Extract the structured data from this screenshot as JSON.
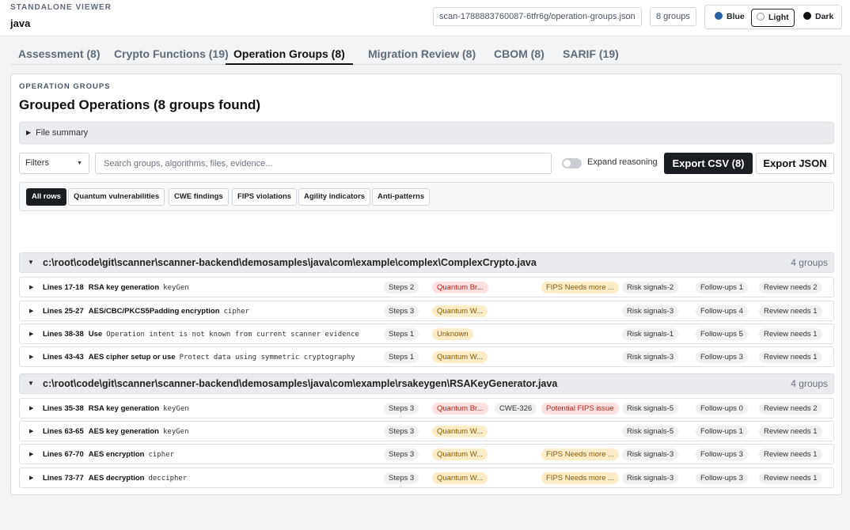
{
  "header": {
    "kicker": "STANDALONE VIEWER",
    "title": "java",
    "scan_file": "scan-1788883760087-6tfr6g/operation-groups.json",
    "group_count": "8 groups",
    "themes": [
      "Blue",
      "Light",
      "Dark"
    ],
    "theme_selected": "Light"
  },
  "tabs": [
    {
      "label": "Assessment (8)"
    },
    {
      "label": "Crypto Functions (19)"
    },
    {
      "label": "Operation Groups (8)"
    },
    {
      "label": "Migration Review (8)"
    },
    {
      "label": "CBOM (8)"
    },
    {
      "label": "SARIF (19)"
    }
  ],
  "active_tab": "Operation Groups (8)",
  "panel": {
    "kicker": "OPERATION GROUPS",
    "title": "Grouped Operations (8 groups found)",
    "file_summary": "File summary",
    "filters_label": "Filters",
    "search_placeholder": "Search groups, algorithms, files, evidence...",
    "expand_label": "Expand reasoning",
    "expand_on": false,
    "export_csv": "Export CSV (8)",
    "export_json": "Export JSON",
    "chips": [
      "All rows",
      "Quantum vulnerabilities",
      "CWE findings",
      "FIPS violations",
      "Agility indicators",
      "Anti-patterns"
    ],
    "chip_active": "All rows"
  },
  "files": [
    {
      "path": "c:\\root\\code\\git\\scanner\\scanner-backend\\demosamples\\java\\com\\example\\complex\\ComplexCrypto.java",
      "count": "4 groups",
      "rows": [
        {
          "lines": "Lines 17-18",
          "name": "RSA key generation",
          "code": "keyGen",
          "steps": "Steps 2",
          "quantum": "Quantum Br...",
          "cwe": "",
          "fips": "FIPS Needs more ...",
          "risk": "Risk signals-2",
          "followups": "Follow-ups 1",
          "review": "Review needs 2"
        },
        {
          "lines": "Lines 25-27",
          "name": "AES/CBC/PKCS5Padding encryption",
          "code": "cipher",
          "steps": "Steps 3",
          "quantum": "Quantum W...",
          "cwe": "",
          "fips": "",
          "risk": "Risk signals-3",
          "followups": "Follow-ups 4",
          "review": "Review needs 1"
        },
        {
          "lines": "Lines 38-38",
          "name": "Use",
          "code": "Operation intent is not known from current scanner evidence",
          "steps": "Steps 1",
          "quantum": "Unknown",
          "cwe": "",
          "fips": "",
          "risk": "Risk signals-1",
          "followups": "Follow-ups 5",
          "review": "Review needs 1"
        },
        {
          "lines": "Lines 43-43",
          "name": "AES cipher setup or use",
          "code": "Protect data using symmetric cryptography",
          "steps": "Steps 1",
          "quantum": "Quantum W...",
          "cwe": "",
          "fips": "",
          "risk": "Risk signals-3",
          "followups": "Follow-ups 3",
          "review": "Review needs 1"
        }
      ]
    },
    {
      "path": "c:\\root\\code\\git\\scanner\\scanner-backend\\demosamples\\java\\com\\example\\rsakeygen\\RSAKeyGenerator.java",
      "count": "4 groups",
      "rows": [
        {
          "lines": "Lines 35-38",
          "name": "RSA key generation",
          "code": "keyGen",
          "steps": "Steps 3",
          "quantum": "Quantum Br...",
          "cwe": "CWE-326",
          "fips": "Potential FIPS issue",
          "risk": "Risk signals-5",
          "followups": "Follow-ups 0",
          "review": "Review needs 2"
        },
        {
          "lines": "Lines 63-65",
          "name": "AES key generation",
          "code": "keyGen",
          "steps": "Steps 3",
          "quantum": "Quantum W...",
          "cwe": "",
          "fips": "",
          "risk": "Risk signals-5",
          "followups": "Follow-ups 1",
          "review": "Review needs 1"
        },
        {
          "lines": "Lines 67-70",
          "name": "AES encryption",
          "code": "cipher",
          "steps": "Steps 3",
          "quantum": "Quantum W...",
          "cwe": "",
          "fips": "FIPS Needs more ...",
          "risk": "Risk signals-3",
          "followups": "Follow-ups 3",
          "review": "Review needs 1"
        },
        {
          "lines": "Lines 73-77",
          "name": "AES decryption",
          "code": "deccipher",
          "steps": "Steps 3",
          "quantum": "Quantum W...",
          "cwe": "",
          "fips": "FIPS Needs more ...",
          "risk": "Risk signals-3",
          "followups": "Follow-ups 3",
          "review": "Review needs 1"
        }
      ]
    }
  ]
}
